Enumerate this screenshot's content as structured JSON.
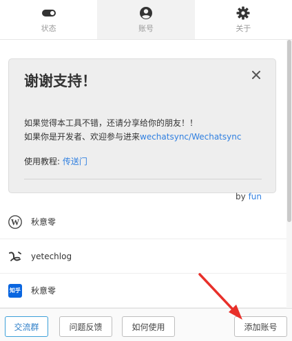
{
  "tabs": [
    {
      "label": "状态",
      "icon": "toggle-icon",
      "active": false
    },
    {
      "label": "账号",
      "icon": "account-circle-icon",
      "active": true
    },
    {
      "label": "关于",
      "icon": "gear-icon",
      "active": false
    }
  ],
  "card": {
    "title": "谢谢支持！",
    "line1": "如果觉得本工具不错，还请分享给你的朋友！！",
    "line2_prefix": "如果你是开发者、欢迎参与进来",
    "line2_link": "wechatsync/Wechatsync",
    "tutorial_label": "使用教程: ",
    "tutorial_link": "传送门",
    "by_label": "by ",
    "by_link": "fun"
  },
  "accounts": [
    {
      "name": "秋意零",
      "icon": "wordpress-icon"
    },
    {
      "name": "yetechlog",
      "icon": "yuque-icon"
    },
    {
      "name": "秋意零",
      "icon": "zhihu-icon",
      "icon_text": "知乎"
    }
  ],
  "buttons": {
    "group": "交流群",
    "feedback": "问题反馈",
    "howto": "如何使用",
    "add": "添加账号"
  },
  "colors": {
    "link": "#2f7fe0",
    "primary_border": "#3b9fd8",
    "zhihu": "#0a66e0",
    "arrow": "#e8302a"
  }
}
